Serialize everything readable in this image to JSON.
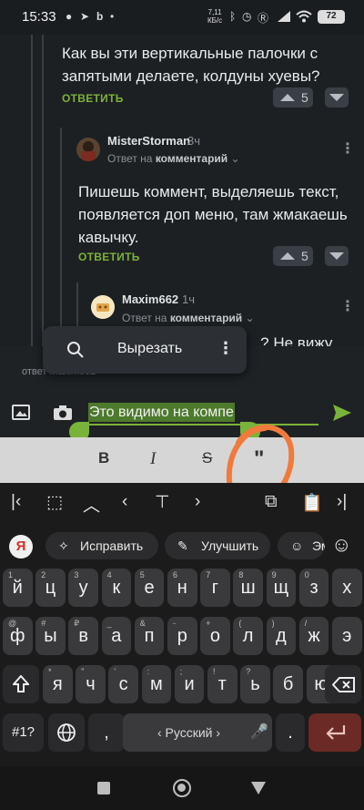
{
  "status_bar": {
    "time": "15:33",
    "net_speed_value": "7,11",
    "net_speed_unit": "КБ/с",
    "battery": "72"
  },
  "comments": [
    {
      "text": "Как вы эти вертикальные палочки с запятыми делаете, колдуны хуевы?",
      "reply_label": "ОТВЕТИТЬ",
      "votes": "5"
    },
    {
      "username": "MisterStorman",
      "time": "3ч",
      "reply_to_prefix": "Ответ на",
      "reply_to_target": "комментарий",
      "text": "Пишешь коммент, выделяешь текст, появляется доп меню, там жмакаешь кавычку.",
      "reply_label": "ОТВЕТИТЬ",
      "votes": "5"
    },
    {
      "username": "Maxim662",
      "time": "1ч",
      "reply_to_prefix": "Ответ на",
      "reply_to_target": "комментарий",
      "text_partial": "...? Не вижу"
    }
  ],
  "context_menu": {
    "cut_label": "Вырезать"
  },
  "compose": {
    "reply_hint": "ответ Maxim662",
    "input_value": "Это видимо на компе"
  },
  "format_bar": {
    "bold": "B",
    "italic": "I",
    "strike": "S",
    "quote": "\""
  },
  "keyboard": {
    "suggestions": [
      "Исправить",
      "Улучшить",
      "Эм"
    ],
    "row1": [
      [
        "й",
        "1"
      ],
      [
        "ц",
        "2"
      ],
      [
        "у",
        "3"
      ],
      [
        "к",
        "4"
      ],
      [
        "е",
        "5"
      ],
      [
        "н",
        "6"
      ],
      [
        "г",
        "7"
      ],
      [
        "ш",
        "8"
      ],
      [
        "щ",
        "9"
      ],
      [
        "з",
        "0"
      ],
      [
        "х",
        ""
      ]
    ],
    "row2": [
      [
        "ф",
        "@"
      ],
      [
        "ы",
        "#"
      ],
      [
        "в",
        "₽"
      ],
      [
        "а",
        "_"
      ],
      [
        "п",
        "&"
      ],
      [
        "р",
        "-"
      ],
      [
        "о",
        "+"
      ],
      [
        "л",
        "("
      ],
      [
        "д",
        ")"
      ],
      [
        "ж",
        "/"
      ],
      [
        "э",
        ""
      ]
    ],
    "row3": [
      [
        "я",
        "*"
      ],
      [
        "ч",
        "\""
      ],
      [
        "с",
        "'"
      ],
      [
        "м",
        ":"
      ],
      [
        "и",
        ";"
      ],
      [
        "т",
        "!"
      ],
      [
        "ь",
        "?"
      ],
      [
        "б",
        ""
      ],
      [
        "ю",
        ""
      ]
    ],
    "symbols_label": "#1?",
    "comma": ",",
    "space_label": "‹ Русский ›",
    "period": "."
  },
  "colors": {
    "accent": "#7ab339",
    "background": "#1d2023",
    "annotation": "#f07a3c"
  }
}
